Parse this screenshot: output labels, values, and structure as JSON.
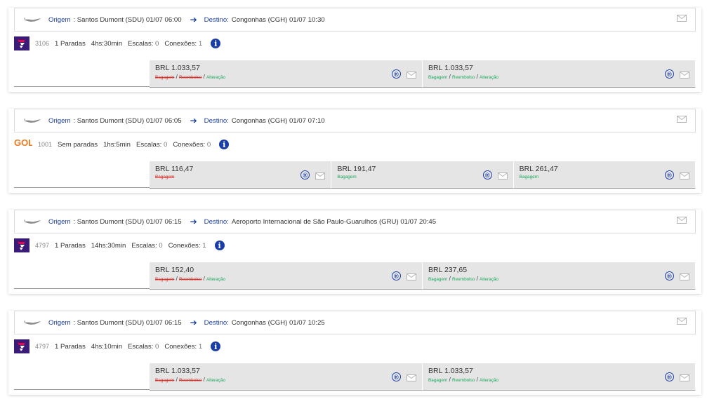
{
  "labels": {
    "origin": "Origem",
    "destination": "Destino:",
    "stops_label": "Escalas:",
    "connections_label": "Conexões:",
    "baggage": "Bagagem",
    "refund": "Reembolso",
    "change": "Alteração",
    "slash": "/",
    "registered": "®",
    "info": "i"
  },
  "colors": {
    "accent": "#1a3ea8",
    "struck": "#d9302a",
    "ok": "#1aa65a",
    "latam": "#3b1b78",
    "gol": "#f47920"
  },
  "flights": [
    {
      "origin_text": ":  Santos Dumont (SDU)  01/07 06:00",
      "dest_text": "Congonhas (CGH)  01/07 10:30",
      "airline": "latam",
      "flight_no": "3106",
      "stops_text": "1 Paradas",
      "duration": "4hs:30min",
      "stops": "0",
      "connections": "1",
      "fares": [
        {
          "price": "BRL 1.033,57",
          "baggage": "struck",
          "refund": "struck",
          "change": "ok"
        },
        {
          "price": "BRL 1.033,57",
          "baggage": "ok",
          "refund": "ok",
          "change": "ok"
        }
      ]
    },
    {
      "origin_text": ":  Santos Dumont (SDU)  01/07 06:05",
      "dest_text": "Congonhas (CGH)  01/07 07:10",
      "airline": "gol",
      "logo_text": "GOL",
      "flight_no": "1001",
      "stops_text": "Sem paradas",
      "duration": "1hs:5min",
      "stops": "0",
      "connections": "0",
      "fares": [
        {
          "price": "BRL 116,47",
          "baggage": "struck"
        },
        {
          "price": "BRL 191,47",
          "baggage": "ok"
        },
        {
          "price": "BRL 261,47",
          "baggage": "ok"
        }
      ]
    },
    {
      "origin_text": ":  Santos Dumont (SDU)  01/07 06:15",
      "dest_text": "Aeroporto Internacional de São Paulo-Guarulhos (GRU)  01/07 20:45",
      "airline": "latam",
      "flight_no": "4797",
      "stops_text": "1 Paradas",
      "duration": "14hs:30min",
      "stops": "0",
      "connections": "1",
      "fares": [
        {
          "price": "BRL 152,40",
          "baggage": "struck",
          "refund": "struck",
          "change": "ok"
        },
        {
          "price": "BRL 237,65",
          "baggage": "ok",
          "refund": "ok",
          "change": "ok"
        }
      ]
    },
    {
      "origin_text": ":  Santos Dumont (SDU)  01/07 06:15",
      "dest_text": "Congonhas (CGH)  01/07 10:25",
      "airline": "latam",
      "flight_no": "4797",
      "stops_text": "1 Paradas",
      "duration": "4hs:10min",
      "stops": "0",
      "connections": "1",
      "fares": [
        {
          "price": "BRL 1.033,57",
          "baggage": "struck",
          "refund": "struck",
          "change": "ok"
        },
        {
          "price": "BRL 1.033,57",
          "baggage": "ok",
          "refund": "ok",
          "change": "ok"
        }
      ]
    }
  ]
}
